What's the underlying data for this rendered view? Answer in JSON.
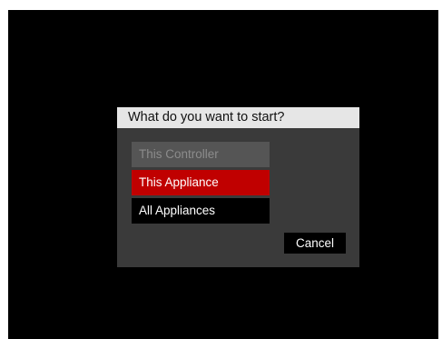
{
  "dialog": {
    "title": "What do you want to start?",
    "options": [
      {
        "label": "This Controller",
        "state": "disabled"
      },
      {
        "label": "This Appliance",
        "state": "selected"
      },
      {
        "label": "All Appliances",
        "state": "normal"
      }
    ],
    "cancel_label": "Cancel"
  },
  "colors": {
    "screen_background": "#000000",
    "dialog_background": "#3a3a3a",
    "title_bar": "#e6e6e6",
    "selected_option": "#c00000",
    "disabled_option": "#555555"
  }
}
